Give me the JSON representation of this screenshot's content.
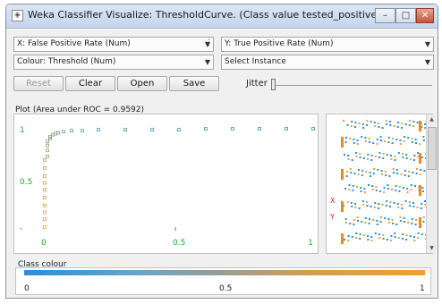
{
  "window": {
    "title": "Weka Classifier Visualize: ThresholdCurve. (Class value tested_positive)",
    "minimize": "–",
    "maximize": "□",
    "close": "✕"
  },
  "selectors": {
    "x_axis": "X: False Positive Rate (Num)",
    "y_axis": "Y: True Positive Rate (Num)",
    "colour": "Colour: Threshold (Num)",
    "instance": "Select Instance"
  },
  "buttons": {
    "reset": "Reset",
    "clear": "Clear",
    "open": "Open",
    "save": "Save"
  },
  "jitter": {
    "label": "Jitter",
    "value": 0
  },
  "plot": {
    "label": "Plot (Area under ROC = 0.9592)"
  },
  "chart_data": {
    "type": "scatter",
    "title": "",
    "xlabel": "",
    "ylabel": "",
    "xlim": [
      0,
      1
    ],
    "ylim": [
      0,
      1
    ],
    "x_ticks": [
      "0",
      "0.5",
      "1"
    ],
    "y_ticks": [
      "1",
      "0.5"
    ],
    "series": [
      {
        "points_x": [
          0,
          0,
          0,
          0,
          0,
          0,
          0,
          0,
          0,
          0,
          0.01,
          0.01,
          0.01,
          0.01,
          0.02,
          0.02,
          0.03,
          0.04,
          0.05,
          0.07,
          0.1,
          0.14,
          0.2,
          0.3,
          0.4,
          0.5,
          0.6,
          0.7,
          0.8,
          0.9,
          1.0
        ],
        "points_y": [
          0.0,
          0.08,
          0.15,
          0.22,
          0.3,
          0.38,
          0.45,
          0.52,
          0.6,
          0.68,
          0.72,
          0.78,
          0.83,
          0.87,
          0.9,
          0.92,
          0.94,
          0.95,
          0.96,
          0.97,
          0.98,
          0.98,
          0.99,
          0.99,
          0.99,
          0.99,
          1.0,
          1.0,
          1.0,
          1.0,
          1.0
        ]
      }
    ]
  },
  "side_panel": {
    "labels": [
      "X",
      "Y"
    ]
  },
  "colour_bar": {
    "label": "Class colour",
    "ticks": [
      "0",
      "0.5",
      "1"
    ],
    "start_color": "#2a8fd8",
    "end_color": "#f0a030"
  }
}
